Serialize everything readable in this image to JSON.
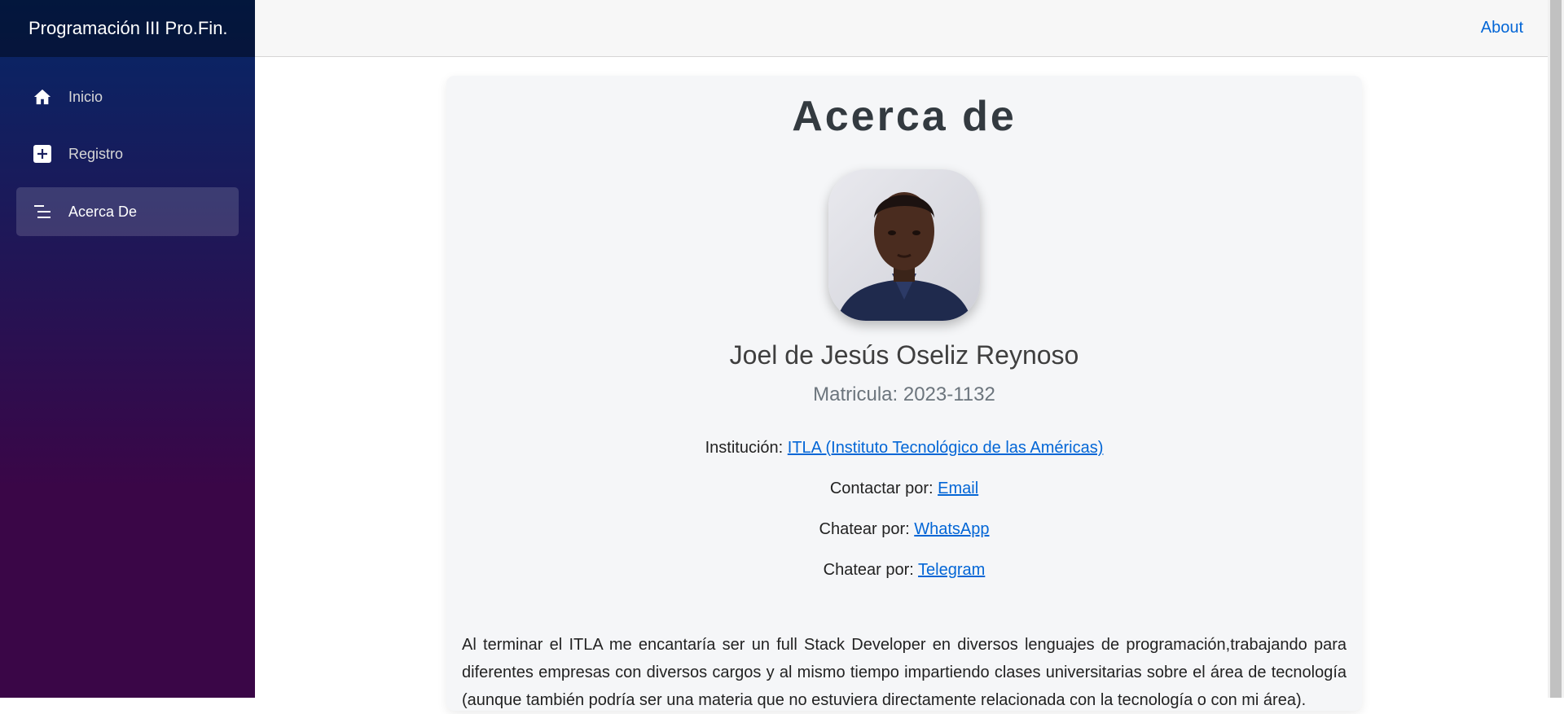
{
  "sidebar": {
    "brand": "Programación III Pro.Fin.",
    "items": [
      {
        "label": "Inicio",
        "icon": "home-icon",
        "active": false
      },
      {
        "label": "Registro",
        "icon": "plus-square-icon",
        "active": false
      },
      {
        "label": "Acerca De",
        "icon": "list-rich-icon",
        "active": true
      }
    ]
  },
  "topbar": {
    "about_label": "About"
  },
  "page": {
    "title": "Acerca de",
    "name": "Joel de Jesús Oseliz Reynoso",
    "matricula": "Matricula: 2023-1132",
    "institution_label": "Institución:",
    "institution_link": "ITLA (Instituto Tecnológico de las Américas)",
    "contact_label": "Contactar por:",
    "contact_link": "Email",
    "whatsapp_label": "Chatear por:",
    "whatsapp_link": "WhatsApp",
    "telegram_label": "Chatear por:",
    "telegram_link": "Telegram",
    "description": "Al terminar el ITLA me encantaría ser un full Stack Developer en diversos lenguajes de programación,trabajando para diferentes empresas con diversos cargos y al mismo tiempo impartiendo clases universitarias sobre el área de tecnología (aunque también podría ser una materia que no estuviera directamente relacionada con la tecnología o con mi área)."
  },
  "colors": {
    "sidebar_top": "#052767",
    "sidebar_bottom": "#3a0647",
    "link": "#0366d6",
    "topbar_bg": "#f7f7f7"
  }
}
